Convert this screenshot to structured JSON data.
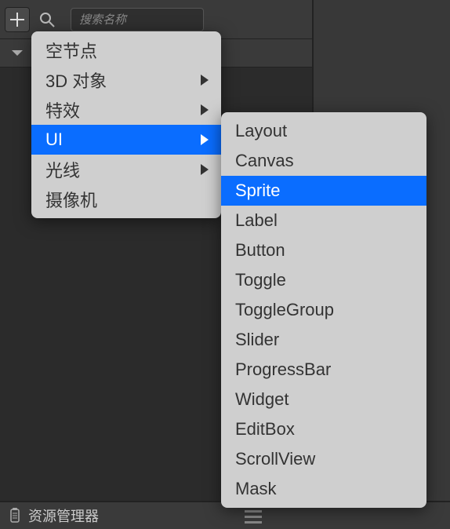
{
  "toolbar": {
    "search_placeholder": "搜索名称"
  },
  "bottom": {
    "label": "资源管理器"
  },
  "main_menu": {
    "items": [
      {
        "label": "空节点",
        "has_children": false
      },
      {
        "label": "3D 对象",
        "has_children": true
      },
      {
        "label": "特效",
        "has_children": true
      },
      {
        "label": "UI",
        "has_children": true
      },
      {
        "label": "光线",
        "has_children": true
      },
      {
        "label": "摄像机",
        "has_children": false
      }
    ],
    "selected_index": 3
  },
  "submenu": {
    "items": [
      "Layout",
      "Canvas",
      "Sprite",
      "Label",
      "Button",
      "Toggle",
      "ToggleGroup",
      "Slider",
      "ProgressBar",
      "Widget",
      "EditBox",
      "ScrollView",
      "Mask"
    ],
    "selected_index": 2
  }
}
